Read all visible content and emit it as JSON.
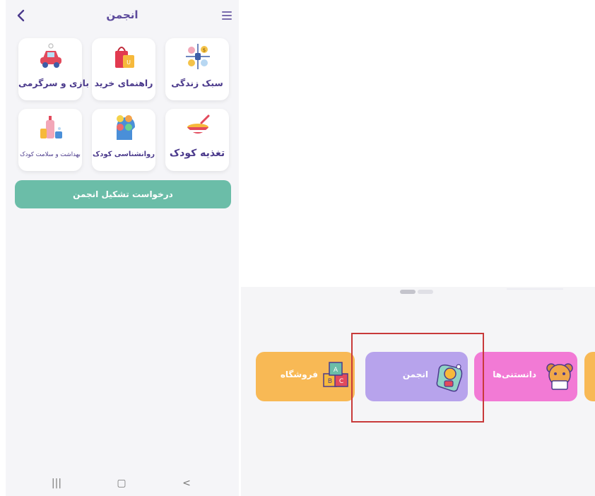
{
  "phone": {
    "title": "انجمن",
    "back_icon": "chevron-left-icon",
    "menu_icon": "hamburger-menu-icon",
    "categories": [
      {
        "label": "سبک زندگی",
        "icon": "lifestyle-icon"
      },
      {
        "label": "راهنمای خرید",
        "icon": "shopping-bag-icon"
      },
      {
        "label": "بازی و سرگرمی",
        "icon": "toy-car-icon"
      },
      {
        "label": "تغذیه کودک",
        "icon": "food-bowl-icon"
      },
      {
        "label": "روانشناسی کودک",
        "icon": "psychology-head-icon"
      },
      {
        "label": "بهداشت و سلامت کودک",
        "icon": "hygiene-bottles-icon"
      }
    ],
    "request_button": "درخواست تشکیل انجمن",
    "navbar": {
      "recent_glyph": "|||",
      "home_glyph": "▢",
      "back_glyph": "<"
    }
  },
  "bottom_menu": {
    "pager_dots": 2,
    "cards": [
      {
        "label": "فروشگاه",
        "icon": "toy-blocks-icon",
        "color": "#f8b955"
      },
      {
        "label": "انجمن",
        "icon": "forum-bag-icon",
        "color": "#b7a3ec"
      },
      {
        "label": "دانستنی‌ها",
        "icon": "bear-book-icon",
        "color": "#f27ad5"
      }
    ],
    "highlighted": "انجمن",
    "highlight_color": "#c83a3a"
  }
}
